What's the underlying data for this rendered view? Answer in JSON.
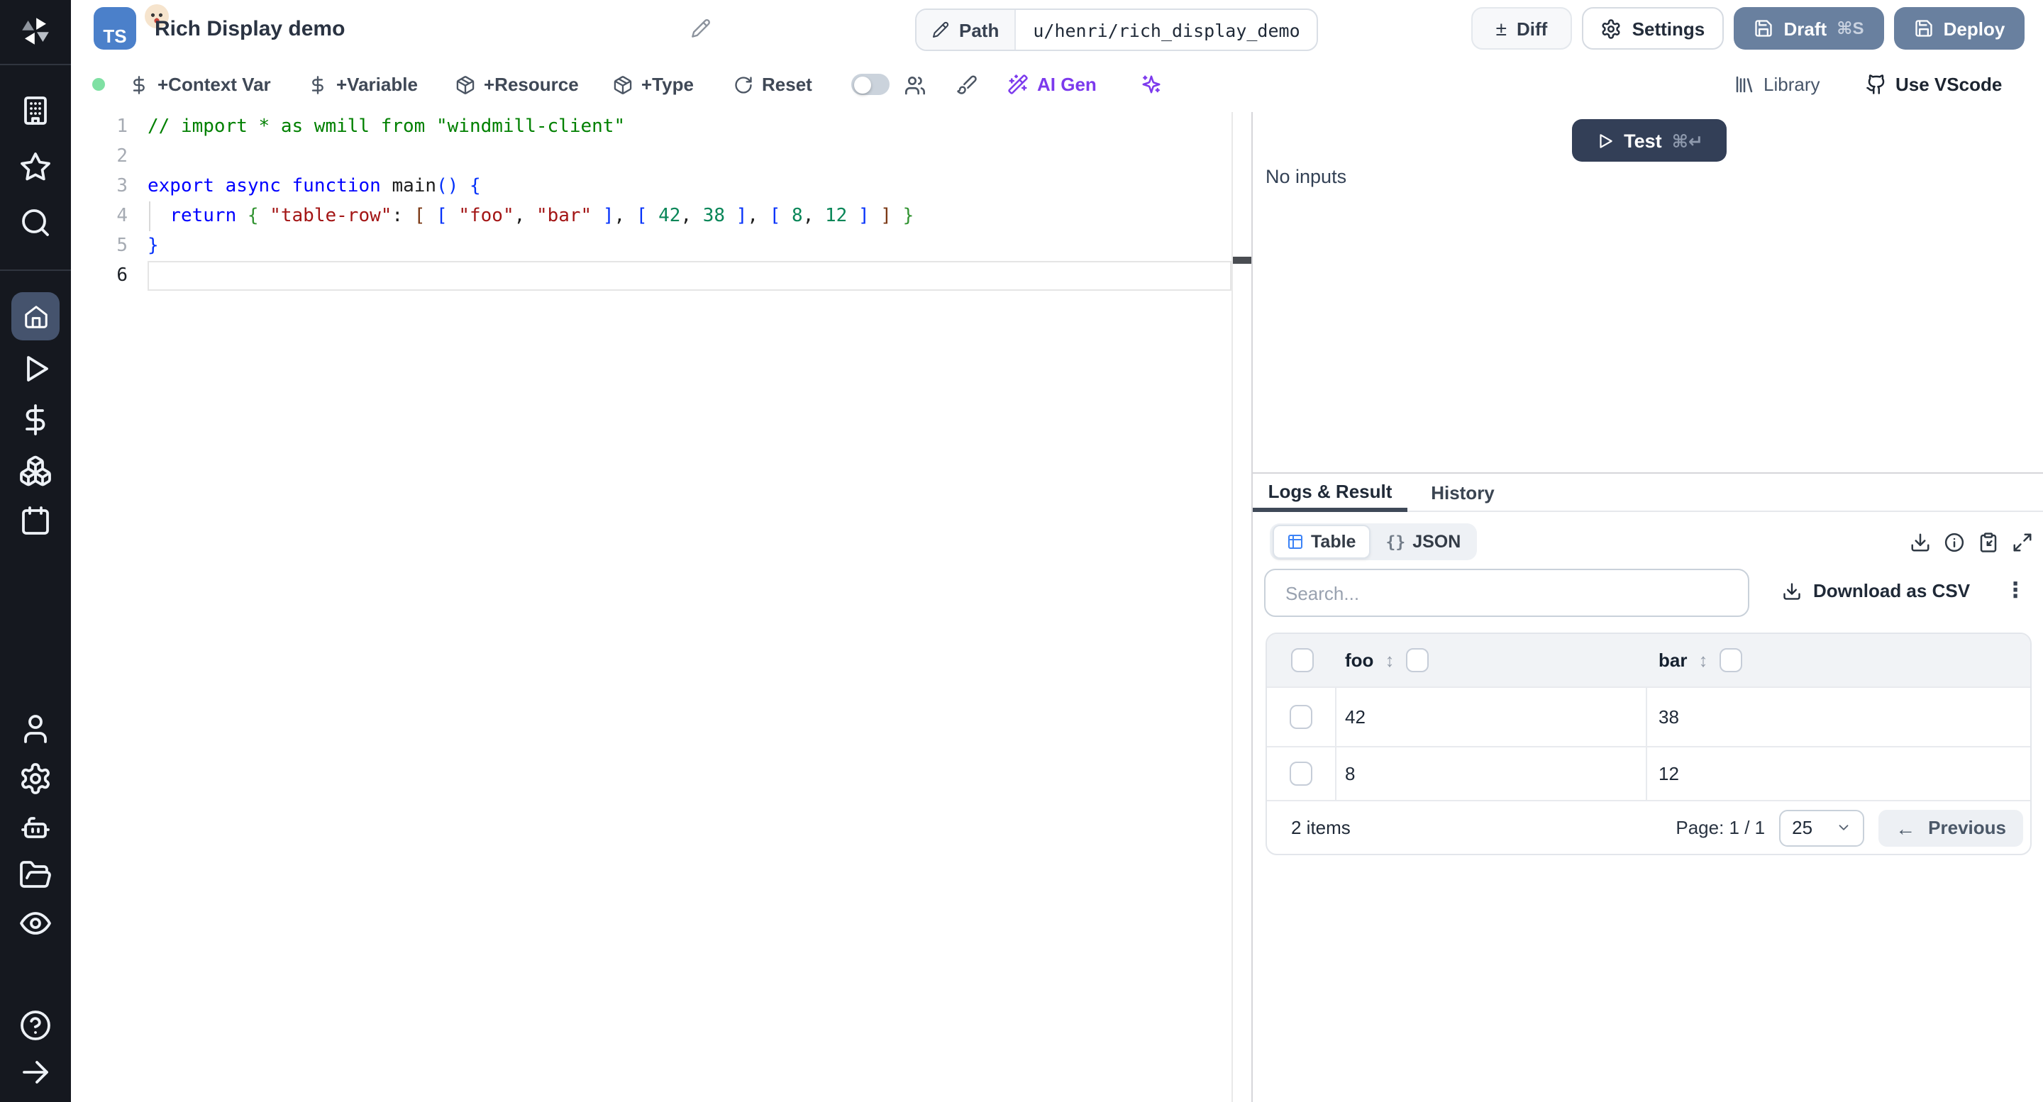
{
  "header": {
    "badge": "TS",
    "title": "Rich Display demo",
    "path": {
      "label": "Path",
      "value": "u/henri/rich_display_demo"
    },
    "buttons": {
      "diff": "Diff",
      "settings": "Settings",
      "draft": "Draft",
      "draft_shortcut": "⌘S",
      "deploy": "Deploy"
    }
  },
  "toolbar": {
    "items": {
      "context_var": "+Context Var",
      "variable": "+Variable",
      "resource": "+Resource",
      "type": "+Type",
      "reset": "Reset",
      "ai_gen": "AI Gen"
    },
    "right": {
      "library": "Library",
      "use_vscode": "Use VScode"
    }
  },
  "editor": {
    "lines": [
      {
        "number": "1",
        "tokens": [
          {
            "cls": "tok-comment",
            "text": "// import * as wmill from \"windmill-client\""
          }
        ]
      },
      {
        "number": "2",
        "tokens": []
      },
      {
        "number": "3",
        "tokens": [
          {
            "cls": "tok-kw",
            "text": "export"
          },
          {
            "cls": "tok-plain",
            "text": " "
          },
          {
            "cls": "tok-kw",
            "text": "async"
          },
          {
            "cls": "tok-plain",
            "text": " "
          },
          {
            "cls": "tok-kw",
            "text": "function"
          },
          {
            "cls": "tok-plain",
            "text": " "
          },
          {
            "cls": "tok-fn",
            "text": "main"
          },
          {
            "cls": "tok-br1",
            "text": "()"
          },
          {
            "cls": "tok-plain",
            "text": " "
          },
          {
            "cls": "tok-br1",
            "text": "{"
          }
        ]
      },
      {
        "number": "4",
        "tokens": [
          {
            "cls": "tok-plain",
            "text": "  "
          },
          {
            "cls": "tok-kw",
            "text": "return"
          },
          {
            "cls": "tok-plain",
            "text": " "
          },
          {
            "cls": "tok-br2",
            "text": "{"
          },
          {
            "cls": "tok-plain",
            "text": " "
          },
          {
            "cls": "tok-str",
            "text": "\"table-row\""
          },
          {
            "cls": "tok-plain",
            "text": ": "
          },
          {
            "cls": "tok-br3",
            "text": "["
          },
          {
            "cls": "tok-plain",
            "text": " "
          },
          {
            "cls": "tok-br1",
            "text": "["
          },
          {
            "cls": "tok-plain",
            "text": " "
          },
          {
            "cls": "tok-str",
            "text": "\"foo\""
          },
          {
            "cls": "tok-plain",
            "text": ", "
          },
          {
            "cls": "tok-str",
            "text": "\"bar\""
          },
          {
            "cls": "tok-plain",
            "text": " "
          },
          {
            "cls": "tok-br1",
            "text": "]"
          },
          {
            "cls": "tok-plain",
            "text": ", "
          },
          {
            "cls": "tok-br1",
            "text": "["
          },
          {
            "cls": "tok-plain",
            "text": " "
          },
          {
            "cls": "tok-num",
            "text": "42"
          },
          {
            "cls": "tok-plain",
            "text": ", "
          },
          {
            "cls": "tok-num",
            "text": "38"
          },
          {
            "cls": "tok-plain",
            "text": " "
          },
          {
            "cls": "tok-br1",
            "text": "]"
          },
          {
            "cls": "tok-plain",
            "text": ", "
          },
          {
            "cls": "tok-br1",
            "text": "["
          },
          {
            "cls": "tok-plain",
            "text": " "
          },
          {
            "cls": "tok-num",
            "text": "8"
          },
          {
            "cls": "tok-plain",
            "text": ", "
          },
          {
            "cls": "tok-num",
            "text": "12"
          },
          {
            "cls": "tok-plain",
            "text": " "
          },
          {
            "cls": "tok-br1",
            "text": "]"
          },
          {
            "cls": "tok-plain",
            "text": " "
          },
          {
            "cls": "tok-br3",
            "text": "]"
          },
          {
            "cls": "tok-plain",
            "text": " "
          },
          {
            "cls": "tok-br2",
            "text": "}"
          }
        ]
      },
      {
        "number": "5",
        "tokens": [
          {
            "cls": "tok-br1",
            "text": "}"
          }
        ]
      },
      {
        "number": "6",
        "tokens": [],
        "active": true
      }
    ]
  },
  "run_panel": {
    "test_button": {
      "label": "Test",
      "shortcut": "⌘↵"
    },
    "no_inputs": "No inputs",
    "tabs": [
      {
        "label": "Logs & Result",
        "active": true
      },
      {
        "label": "History",
        "active": false
      }
    ],
    "view_toggle": [
      {
        "label": "Table",
        "active": true
      },
      {
        "label": "JSON",
        "active": false
      }
    ],
    "search_placeholder": "Search...",
    "download_csv": "Download as CSV",
    "table": {
      "columns": [
        "foo",
        "bar"
      ],
      "rows": [
        [
          "42",
          "38"
        ],
        [
          "8",
          "12"
        ]
      ],
      "items_count": "2 items",
      "page_label": "Page: 1 / 1",
      "page_size": "25",
      "previous": "Previous"
    }
  },
  "icons": {
    "diff_glyph": "±",
    "sort_glyph": "↕",
    "braces_glyph": "{}",
    "kebab_glyph": "⋮",
    "prev_arrow_glyph": "←"
  },
  "sidebar_icon_names": [
    "windmill-logo",
    "workspace-building",
    "favorites-star",
    "search",
    "home",
    "runs-play",
    "variables-dollar",
    "resources-boxes",
    "schedules-calendar",
    "user",
    "settings-gear",
    "workers-robot",
    "folders",
    "audit-eye",
    "help",
    "expand-arrow"
  ],
  "colors": {
    "sidebar_bg": "#15181f",
    "sidebar_active_bg": "#45536d",
    "primary_button_bg": "#69809f",
    "test_button_bg": "#333f57",
    "accent_purple": "#7c3aed",
    "status_green": "#7fe0a3",
    "table_icon_blue": "#3b82f6",
    "ts_badge_blue": "#4b80ca",
    "code_keyword": "#0000ff",
    "code_string": "#a31515",
    "code_number": "#098658",
    "code_comment": "#008000"
  }
}
